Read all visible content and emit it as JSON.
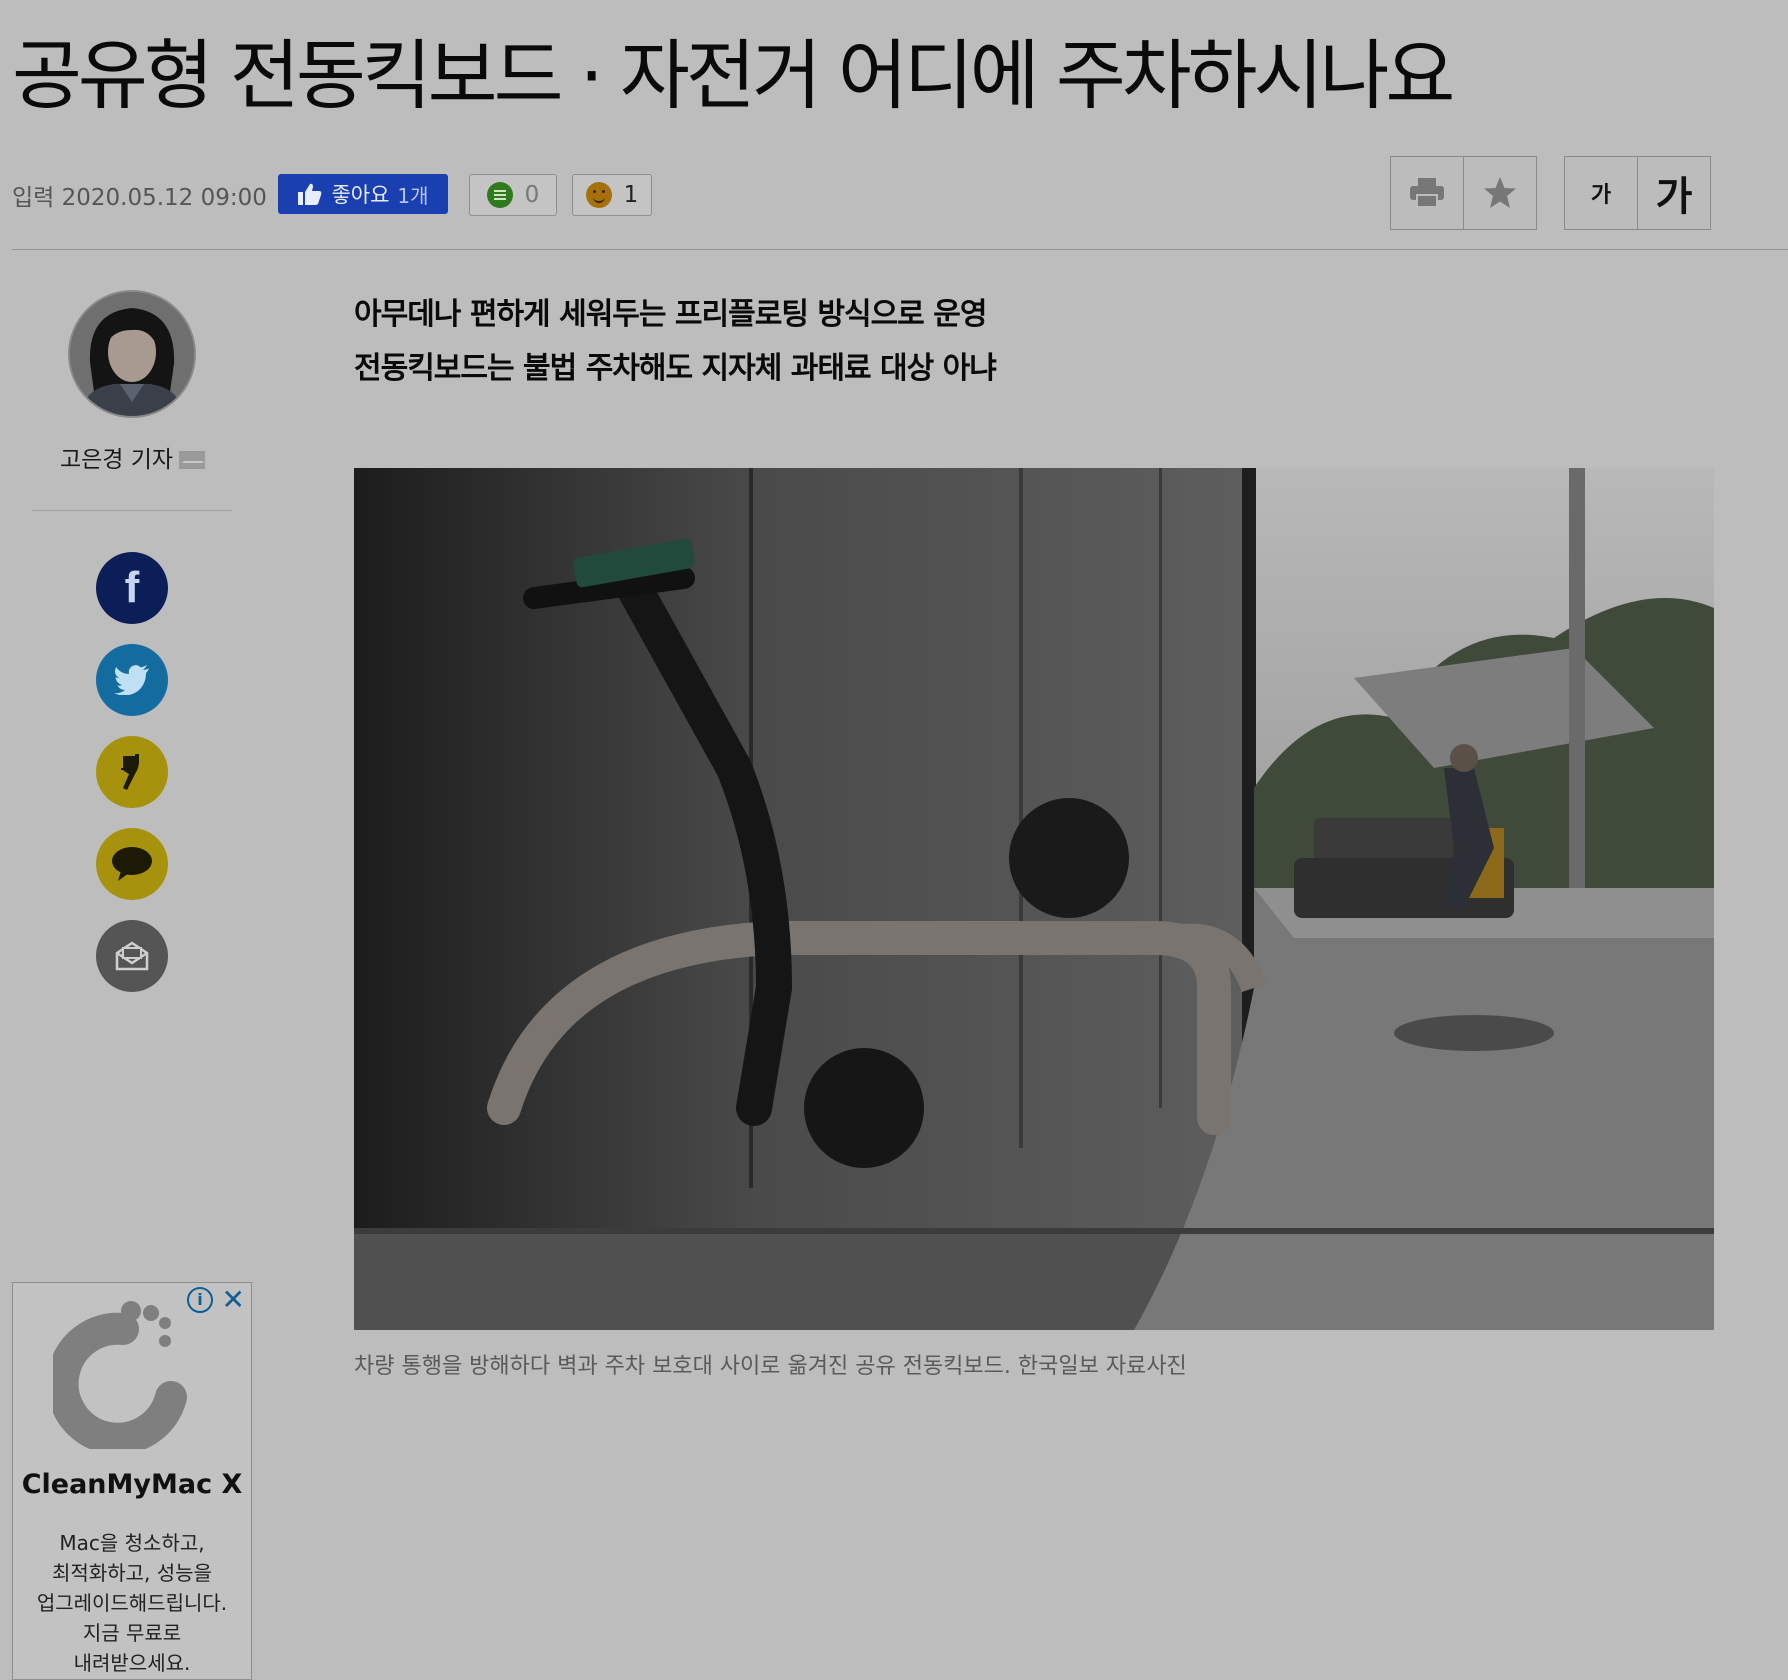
{
  "article": {
    "headline": "공유형 전동킥보드 · 자전거 어디에 주차하시나요",
    "published": "입력 2020.05.12 09:00",
    "like_label": "좋아요",
    "like_count": "1개",
    "comment_count": "0",
    "reaction_count": "1",
    "font_small_label": "가",
    "font_large_label": "가",
    "subheadlines": [
      "아무데나 편하게 세워두는 프리플로팅 방식으로 운영",
      "전동킥보드는 불법 주차해도 지자체 과태료 대상 아냐"
    ],
    "photo_caption": "차량 통행을 방해하다 벽과 주차 보호대 사이로 옮겨진 공유 전동킥보드. 한국일보 자료사진"
  },
  "author": {
    "name": "고은경 기자"
  },
  "share": {
    "facebook_glyph": "f"
  },
  "ad": {
    "info_glyph": "i",
    "close_glyph": "✕",
    "title": "CleanMyMac X",
    "body_lines": [
      "Mac을 청소하고,",
      "최적화하고, 성능을",
      "업그레이드해드립니다.",
      "지금 무료로",
      "내려받으세요."
    ]
  },
  "icons": {
    "like": "thumbs-up-icon",
    "comment": "comment-icon",
    "reaction": "smiley-icon",
    "print": "print-icon",
    "bookmark": "star-icon",
    "mail": "mail-icon"
  },
  "colors": {
    "like_button": "#1a3fb0",
    "facebook": "#0b1e57",
    "twitter": "#146c9e",
    "kakao": "#a7920d",
    "email": "#555555",
    "ad_accent": "#0f5f94"
  }
}
